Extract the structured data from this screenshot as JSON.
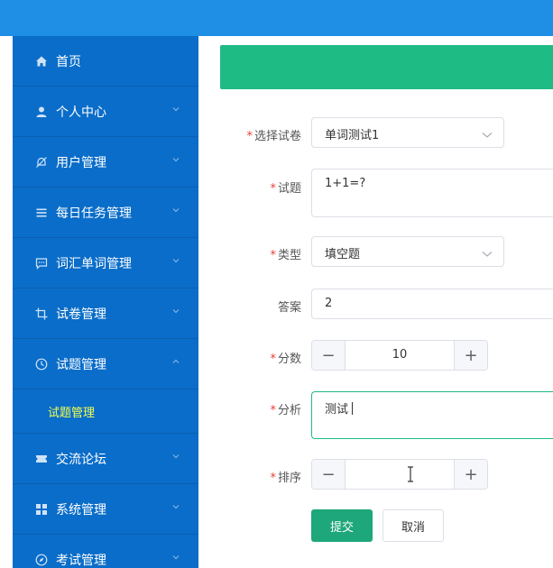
{
  "sidebar": {
    "items": [
      {
        "label": "首页",
        "icon": "home-icon"
      },
      {
        "label": "个人中心",
        "icon": "user-icon"
      },
      {
        "label": "用户管理",
        "icon": "bell-off-icon"
      },
      {
        "label": "每日任务管理",
        "icon": "list-icon"
      },
      {
        "label": "词汇单词管理",
        "icon": "chat-icon"
      },
      {
        "label": "试卷管理",
        "icon": "crop-icon"
      },
      {
        "label": "试题管理",
        "icon": "clock-icon"
      },
      {
        "label": "交流论坛",
        "icon": "ticket-icon"
      },
      {
        "label": "系统管理",
        "icon": "grid-icon"
      },
      {
        "label": "考试管理",
        "icon": "compass-icon"
      }
    ],
    "submenu_active": "试题管理"
  },
  "form": {
    "paper": {
      "label": "选择试卷",
      "value": "单词测试1"
    },
    "question": {
      "label": "试题",
      "value": "1+1=?"
    },
    "type": {
      "label": "类型",
      "value": "填空题"
    },
    "answer": {
      "label": "答案",
      "value": "2"
    },
    "score": {
      "label": "分数",
      "value": "10",
      "minus": "−",
      "plus": "+"
    },
    "analysis": {
      "label": "分析",
      "value": "测试"
    },
    "order": {
      "label": "排序",
      "value": "",
      "minus": "−",
      "plus": "+"
    },
    "required_mark": "*",
    "submit_label": "提交",
    "cancel_label": "取消"
  },
  "colors": {
    "topbar": "#1f8fe6",
    "sidebar": "#0a6dc9",
    "banner": "#1ebb84",
    "submit": "#1ea77a",
    "active_submenu_text": "#f3ff4f",
    "required": "#e8403b"
  }
}
